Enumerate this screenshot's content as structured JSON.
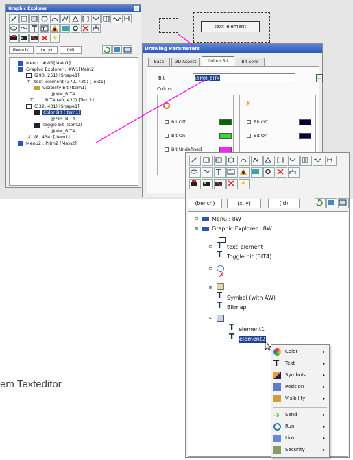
{
  "caption": "em Texteditor",
  "explorer": {
    "title": "Graphic Explorer",
    "filters": [
      "(bench)",
      "(x, y)",
      "(id)"
    ],
    "tree": [
      "Menu : #W1[Main1]",
      "Graphic Explorer : #W1[Main2]",
      "(290, 251) [Shape1]",
      "text_element (372, 430) [Text1]",
      "Visibility bit (Item1)",
      "@MM_BIT4",
      "BIT4 (40, 430) [Text2]",
      "(332, 431) [Shape1]",
      "Color Bit (Item1)",
      "@MM_BIT4",
      "Toggle bit (Item2)",
      "@MM_BIT4",
      "(8, 434) [Item1]",
      "Menu2 : Prim2 [Main2]"
    ]
  },
  "canvas": {
    "text_element_label": "text_element"
  },
  "drawing_params": {
    "title": "Drawing Parameters",
    "tabs": [
      "Base",
      "3D Aspect",
      "Colour Bit",
      "Bit Send"
    ],
    "bit_label": "Bit",
    "bit_value": "@MM_BIT4",
    "bit_button": "...",
    "colors_label": "Colors",
    "rows": [
      {
        "label": "Bit Off",
        "color_left": "#006600",
        "color_right": "#000033"
      },
      {
        "label": "Bit On",
        "color_left": "#33dd33",
        "color_right": "#000044"
      },
      {
        "label": "Bit Undefined",
        "color_left": "#ff22ff",
        "color_right": "#222266"
      }
    ]
  },
  "explorer2": {
    "filters": [
      "(bench)",
      "(x, y)",
      "(id)"
    ],
    "tree": {
      "menu": "Menu : 8W",
      "graphic_explorer": "Graphic Explorer : 8W",
      "text_element": "text_element",
      "toggle_bit": "Toggle bit (BIT4)",
      "symbol": "Symbol (with AW)",
      "bitmap": "Bitmap",
      "element1": "element1",
      "element2": "element2"
    }
  },
  "context_menu": {
    "items": [
      "Color",
      "Text",
      "Symbols",
      "Position",
      "Visibility",
      "Send",
      "Run",
      "Link",
      "Security"
    ]
  }
}
